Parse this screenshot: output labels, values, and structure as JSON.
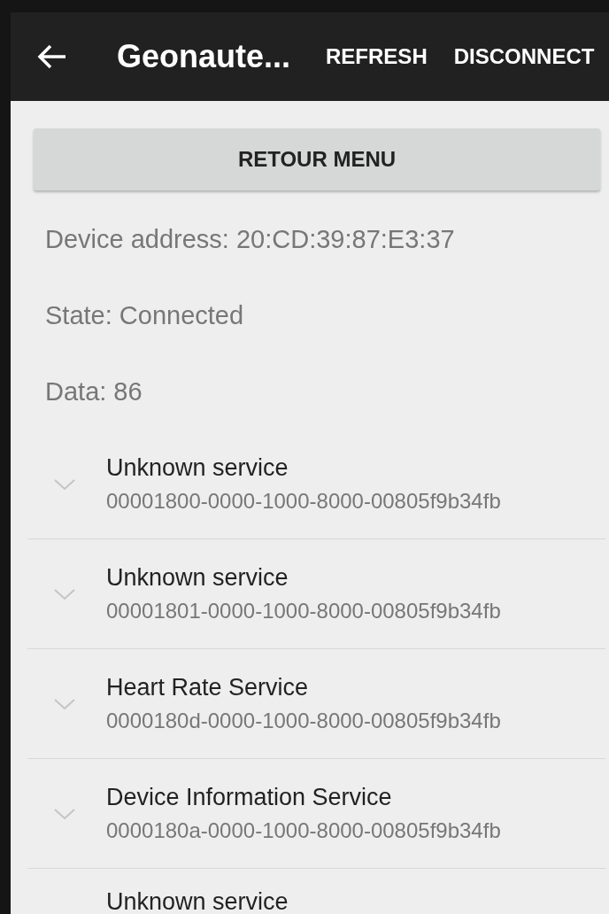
{
  "app_bar": {
    "title": "Geonaute...",
    "actions": [
      "REFRESH",
      "DISCONNECT"
    ]
  },
  "button": {
    "label": "RETOUR MENU"
  },
  "info": [
    "Device address: 20:CD:39:87:E3:37",
    "State: Connected",
    "Data: 86"
  ],
  "services": [
    {
      "name": "Unknown service",
      "uuid": "00001800-0000-1000-8000-00805f9b34fb",
      "expanded": false
    },
    {
      "name": "Unknown service",
      "uuid": "00001801-0000-1000-8000-00805f9b34fb",
      "expanded": false
    },
    {
      "name": "Heart Rate Service",
      "uuid": "0000180d-0000-1000-8000-00805f9b34fb",
      "expanded": false
    },
    {
      "name": "Device Information Service",
      "uuid": "0000180a-0000-1000-8000-00805f9b34fb",
      "expanded": false
    },
    {
      "name": "Unknown service"
    }
  ]
}
